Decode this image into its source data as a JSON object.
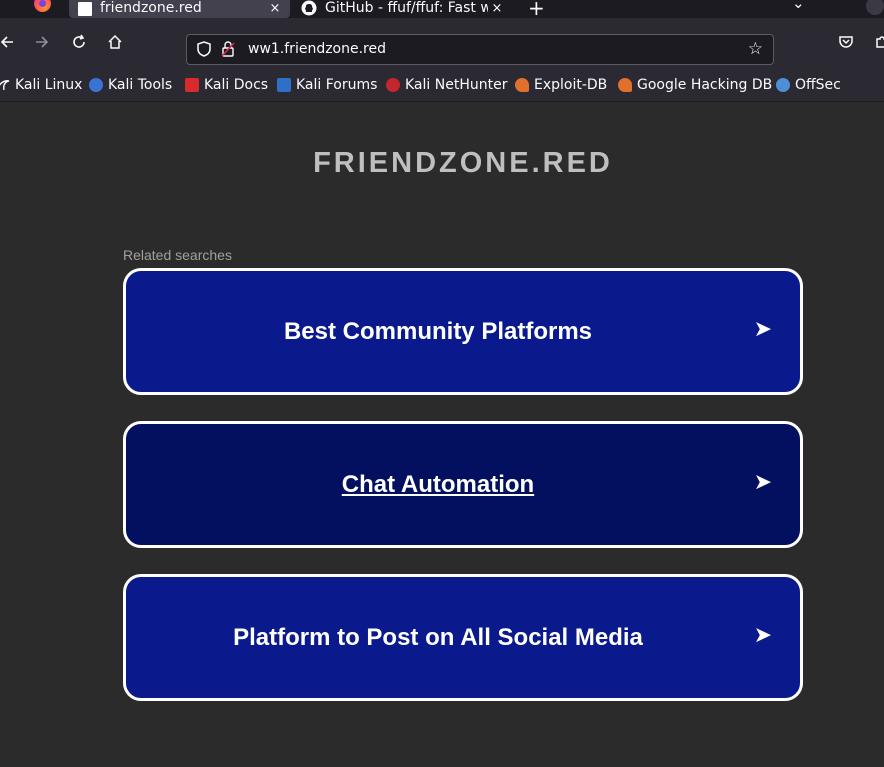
{
  "browser": {
    "tabs": [
      {
        "title": "friendzone.red",
        "active": true
      },
      {
        "title": "GitHub - ffuf/ffuf: Fast we",
        "active": false
      }
    ],
    "new_tab_symbol": "+",
    "close_symbol": "×",
    "list_tabs_symbol": "⌄",
    "url": "ww1.friendzone.red",
    "bookmark_star": "☆",
    "bookmarks": [
      {
        "label": "Kali Linux",
        "icon": "kali-linux-icon"
      },
      {
        "label": "Kali Tools",
        "icon": "kali-tools-icon"
      },
      {
        "label": "Kali Docs",
        "icon": "kali-docs-icon"
      },
      {
        "label": "Kali Forums",
        "icon": "kali-forums-icon"
      },
      {
        "label": "Kali NetHunter",
        "icon": "kali-nethunter-icon"
      },
      {
        "label": "Exploit-DB",
        "icon": "exploit-db-icon"
      },
      {
        "label": "Google Hacking DB",
        "icon": "google-hacking-db-icon"
      },
      {
        "label": "OffSec",
        "icon": "offsec-icon"
      }
    ]
  },
  "page": {
    "site_title": "FRIENDZONE.RED",
    "related_label": "Related searches",
    "searches": [
      {
        "label": "Best Community Platforms"
      },
      {
        "label": "Chat Automation"
      },
      {
        "label": "Platform to Post on All Social Media"
      }
    ],
    "arrow_symbol": "➤"
  },
  "colors": {
    "card_blue": "#0a1a8c",
    "card_dark_blue": "#031060",
    "page_background": "#2b2b2b",
    "title_gray": "#bfbfbf"
  }
}
